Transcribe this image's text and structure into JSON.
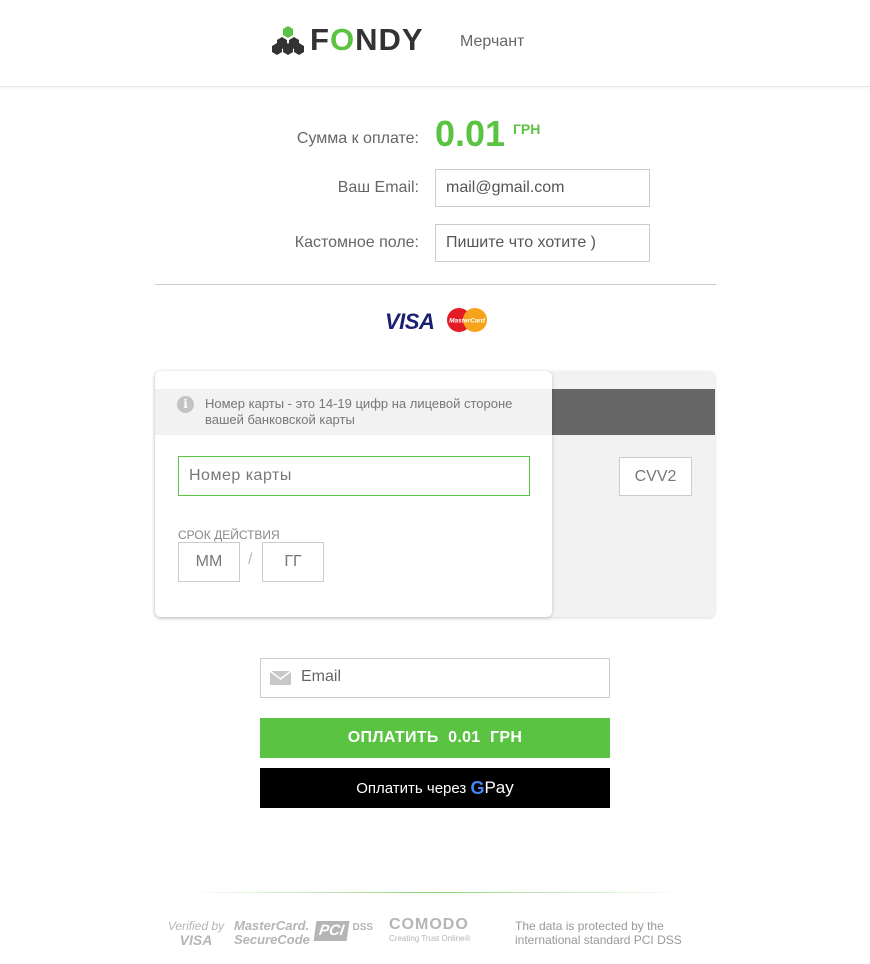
{
  "header": {
    "brand": "FONDY",
    "brand_pre": "F",
    "brand_o": "O",
    "brand_post": "NDY",
    "merchant": "Мерчант"
  },
  "payment": {
    "amount_label": "Сумма к оплате:",
    "amount": "0.01",
    "currency": "ГРН",
    "email_label": "Ваш Email:",
    "email_value": "mail@gmail.com",
    "custom_label": "Кастомное поле:",
    "custom_value": "Пишите что хотите )"
  },
  "card_brands": {
    "visa": "VISA",
    "mastercard": "MasterCard"
  },
  "card_form": {
    "hint": "Номер карты - это 14-19 цифр на лицевой стороне вашей банковской карты",
    "card_number_placeholder": "Номер карты",
    "expiry_label": "СРОК ДЕЙСТВИЯ",
    "month_placeholder": "ММ",
    "separator": "/",
    "year_placeholder": "ГГ",
    "cvv_placeholder": "CVV2"
  },
  "actions": {
    "email_placeholder": "Email",
    "pay_button": "ОПЛАТИТЬ  0.01  ГРН",
    "gpay_prefix": "Оплатить через",
    "gpay_g": "G",
    "gpay_pay": "Pay"
  },
  "footer": {
    "verified_top": "Verified by",
    "verified_bottom": "VISA",
    "mc_top": "MasterCard.",
    "mc_bottom": "SecureCode",
    "pci": "PCI",
    "dss": "DSS",
    "comodo": "COMODO",
    "comodo_sub": "Creating Trust Online®",
    "protection_text": "The data is protected by the international standard PCI DSS"
  },
  "colors": {
    "accent": "#5ac341",
    "dark": "#000000",
    "text": "#666666"
  }
}
